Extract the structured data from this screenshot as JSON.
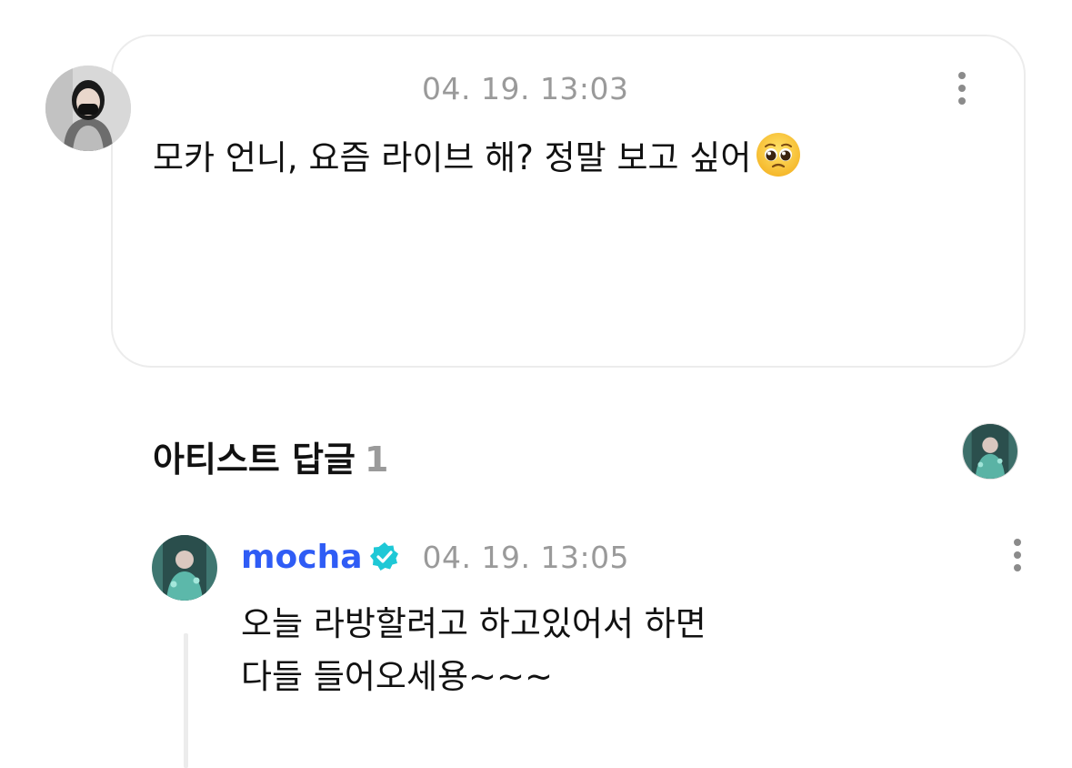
{
  "fan_comment": {
    "avatar_icon": "user-avatar-masked-woman",
    "timestamp": "04. 19. 13:03",
    "text": "모카 언니, 요즘 라이브 해? 정말 보고 싶어",
    "emoji": "pleading-face-emoji",
    "more_icon": "kebab-menu-icon"
  },
  "artist_reply_section": {
    "title": "아티스트 답글",
    "count": "1",
    "header_avatar_icon": "artist-avatar-icon"
  },
  "artist_reply": {
    "name": "mocha",
    "verified_icon": "verified-badge-icon",
    "timestamp": "04. 19. 13:05",
    "text_line1": "오늘 라방할려고 하고있어서 하면",
    "text_line2": "다들 들어오세용~~~",
    "more_icon": "kebab-menu-icon"
  },
  "colors": {
    "artist_name": "#2f5cf5",
    "verified_badge": "#1ec8d6",
    "timestamp": "#9a9a9a",
    "card_border": "#ececec"
  }
}
